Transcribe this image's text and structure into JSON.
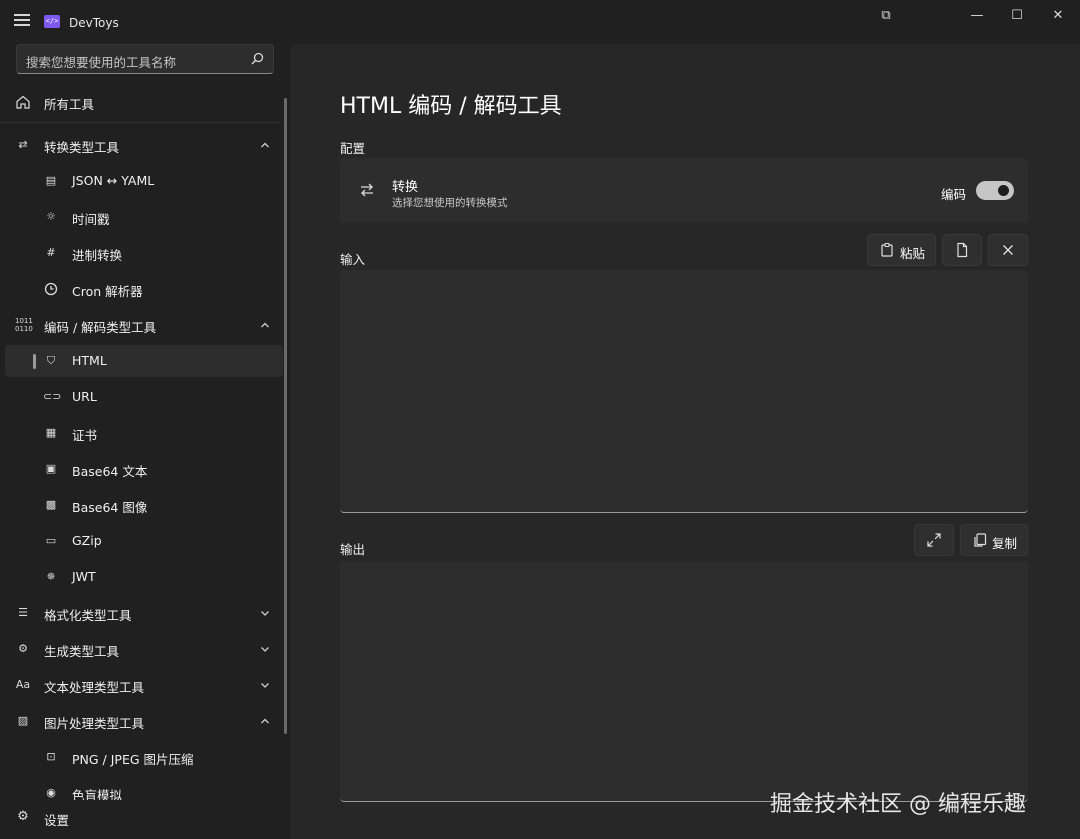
{
  "app": {
    "title": "DevToys",
    "logo_text": "</>"
  },
  "window_controls": {
    "compact": "⧉",
    "minimize": "—",
    "maximize": "☐",
    "close": "✕"
  },
  "search": {
    "placeholder": "搜索您想要使用的工具名称"
  },
  "sidebar": {
    "all_tools": "所有工具",
    "groups": {
      "converters": {
        "label": "转换类型工具",
        "items": [
          "JSON ↔ YAML",
          "时间戳",
          "进制转换",
          "Cron 解析器"
        ]
      },
      "encoders": {
        "label": "编码 / 解码类型工具",
        "items": [
          "HTML",
          "URL",
          "证书",
          "Base64 文本",
          "Base64 图像",
          "GZip",
          "JWT"
        ]
      },
      "formatters": {
        "label": "格式化类型工具"
      },
      "generators": {
        "label": "生成类型工具"
      },
      "text": {
        "label": "文本处理类型工具"
      },
      "graphic": {
        "label": "图片处理类型工具",
        "items": [
          "PNG / JPEG 图片压缩",
          "色盲模拟"
        ]
      }
    },
    "settings": "设置"
  },
  "main": {
    "title": "HTML 编码 / 解码工具",
    "config_label": "配置",
    "conversion": {
      "title": "转换",
      "description": "选择您想使用的转换模式",
      "toggle_label": "编码",
      "toggle_on": true
    },
    "input": {
      "label": "输入",
      "paste_label": "粘贴",
      "value": ""
    },
    "output": {
      "label": "输出",
      "copy_label": "复制",
      "value": ""
    }
  },
  "watermark": "掘金技术社区 @ 编程乐趣",
  "colors": {
    "background": "#202020",
    "content": "#272727",
    "card": "#2d2d2d",
    "accent": "#7f5af0"
  }
}
